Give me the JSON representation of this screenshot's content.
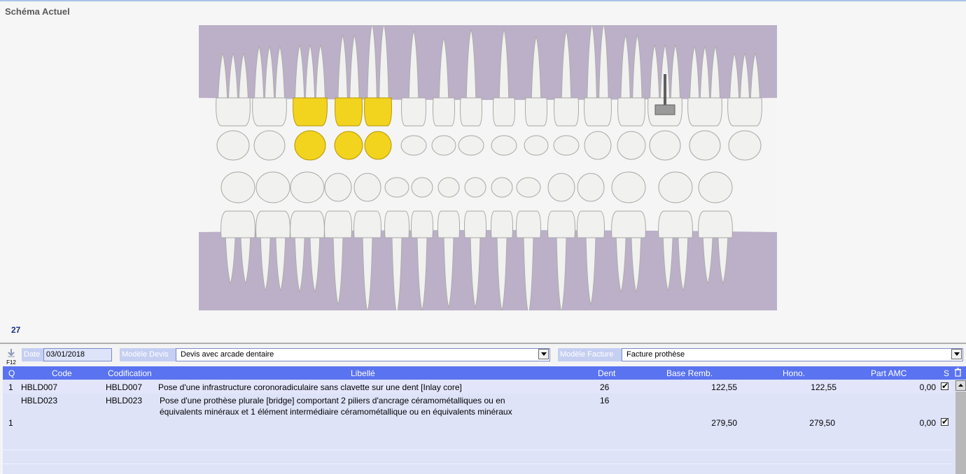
{
  "panel": {
    "title": "Schéma Actuel",
    "selected_count": "27"
  },
  "chart": {
    "colors": {
      "background": "#f5f5f5",
      "gum": "#bbb0c8",
      "tooth": "#f1f1ef",
      "tooth_edge": "#a8a8a4",
      "selected": "#f2d41e",
      "selected_edge": "#b89600",
      "post": "#5e5e5e"
    },
    "upper_teeth": [
      {
        "id": "18",
        "kind": "molar",
        "state": "none"
      },
      {
        "id": "17",
        "kind": "molar",
        "state": "none"
      },
      {
        "id": "16",
        "kind": "molar",
        "state": "crown"
      },
      {
        "id": "15",
        "kind": "premolar",
        "state": "crown"
      },
      {
        "id": "14",
        "kind": "premolar",
        "state": "crown"
      },
      {
        "id": "13",
        "kind": "canine",
        "state": "none"
      },
      {
        "id": "12",
        "kind": "incisor",
        "state": "none"
      },
      {
        "id": "11",
        "kind": "incisor",
        "state": "none"
      },
      {
        "id": "21",
        "kind": "incisor",
        "state": "none"
      },
      {
        "id": "22",
        "kind": "incisor",
        "state": "none"
      },
      {
        "id": "23",
        "kind": "canine",
        "state": "none"
      },
      {
        "id": "24",
        "kind": "premolar",
        "state": "none"
      },
      {
        "id": "25",
        "kind": "premolar",
        "state": "none"
      },
      {
        "id": "26",
        "kind": "molar",
        "state": "post"
      },
      {
        "id": "27",
        "kind": "molar",
        "state": "none"
      },
      {
        "id": "28",
        "kind": "molar",
        "state": "none"
      }
    ],
    "lower_teeth": [
      {
        "id": "48",
        "kind": "molar"
      },
      {
        "id": "47",
        "kind": "molar"
      },
      {
        "id": "46",
        "kind": "molar"
      },
      {
        "id": "45",
        "kind": "premolar"
      },
      {
        "id": "44",
        "kind": "premolar"
      },
      {
        "id": "43",
        "kind": "canine"
      },
      {
        "id": "42",
        "kind": "incisor"
      },
      {
        "id": "41",
        "kind": "incisor"
      },
      {
        "id": "31",
        "kind": "incisor"
      },
      {
        "id": "32",
        "kind": "incisor"
      },
      {
        "id": "33",
        "kind": "canine"
      },
      {
        "id": "34",
        "kind": "premolar"
      },
      {
        "id": "35",
        "kind": "premolar"
      },
      {
        "id": "36",
        "kind": "molar"
      },
      {
        "id": "37",
        "kind": "molar"
      },
      {
        "id": "38",
        "kind": "molar"
      }
    ]
  },
  "toolbar": {
    "export_key": "F12",
    "date_label": "Date",
    "date_value": "03/01/2018",
    "devis_label": "Modèle Devis",
    "devis_value": "Devis avec arcade dentaire",
    "facture_label": "Modèle Facture",
    "facture_value": "Facture prothèse"
  },
  "table": {
    "columns": {
      "q": "Q",
      "code": "Code",
      "codification": "Codification",
      "libelle": "Libellé",
      "dent": "Dent",
      "base": "Base Remb.",
      "hono": "Hono.",
      "amc": "Part AMC",
      "s": "S"
    },
    "rows": [
      {
        "q": "1",
        "code": "HBLD007",
        "codification": "HBLD007",
        "libelle_1": "Pose d'une infrastructure coronoradiculaire sans clavette sur une dent [Inlay core]",
        "libelle_2": "",
        "dent": "26",
        "base": "122,55",
        "hono": "122,55",
        "amc": "0,00",
        "s": "✔"
      },
      {
        "q": "1",
        "code": "HBLD023",
        "codification": "HBLD023",
        "libelle_1": "Pose d'une prothèse plurale [bridge] comportant 2 piliers d'ancrage céramométalliques ou en",
        "libelle_2": "équivalents minéraux et 1 élément intermédiaire céramométallique ou en équivalents minéraux",
        "dent": "16",
        "base": "279,50",
        "hono": "279,50",
        "amc": "0,00",
        "s": "✔"
      }
    ]
  }
}
